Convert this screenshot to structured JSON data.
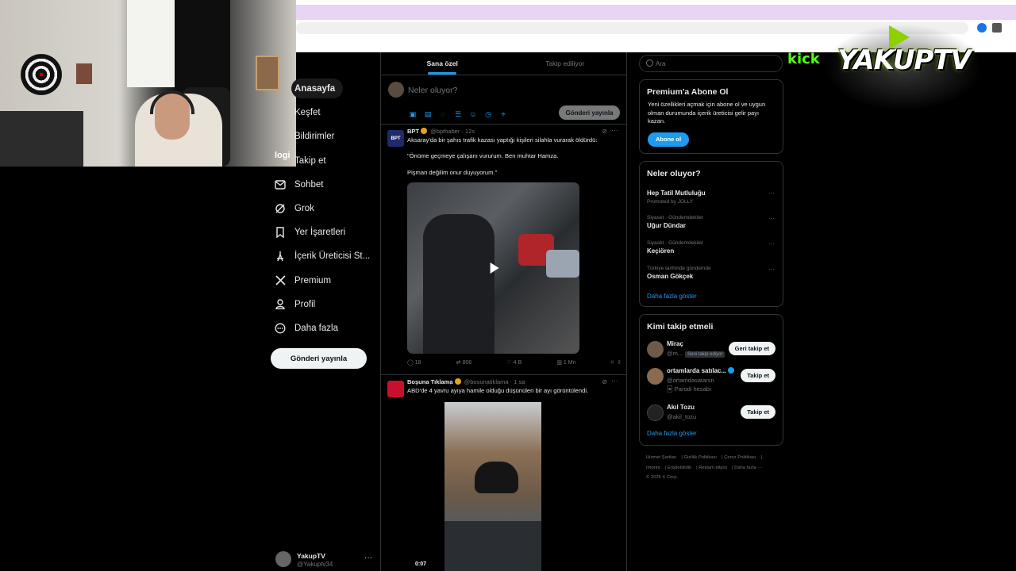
{
  "nav": {
    "items": [
      {
        "label": "Anasayfa",
        "icon": "home-icon"
      },
      {
        "label": "Keşfet",
        "icon": "search-icon"
      },
      {
        "label": "Bildirimler",
        "icon": "bell-icon"
      },
      {
        "label": "Takip et",
        "icon": "follow-icon"
      },
      {
        "label": "Sohbet",
        "icon": "mail-icon"
      },
      {
        "label": "Grok",
        "icon": "grok-icon"
      },
      {
        "label": "Yer İşaretleri",
        "icon": "bookmark-icon"
      },
      {
        "label": "İçerik Üreticisi St...",
        "icon": "creator-studio-icon"
      },
      {
        "label": "Premium",
        "icon": "x-logo-icon"
      },
      {
        "label": "Profil",
        "icon": "profile-icon"
      },
      {
        "label": "Daha fazla",
        "icon": "more-circle-icon"
      }
    ],
    "post_button": "Gönderi yayınla"
  },
  "account": {
    "name": "YakupTV",
    "handle": "@Yakuptv34",
    "more": "···"
  },
  "overlay": {
    "logi": "logi",
    "kick": "kick",
    "yakup": "YAKUPTV"
  },
  "tabs": [
    {
      "label": "Sana özel",
      "active": true
    },
    {
      "label": "Takip ediliyor",
      "active": false
    }
  ],
  "composer": {
    "placeholder": "Neler oluyor?",
    "post_button": "Gönderi yayınla"
  },
  "tweets": [
    {
      "name": "BPT",
      "handle": "@bpthaber · 12s",
      "lines": [
        "Aksaray'da bir şahıs trafik kazası yaptığı kişileri silahla vurarak öldürdü:",
        "\"Önüme geçmeye çalışanı vururum. Ben muhtar Hamza.",
        "Pişman değilim onur duyuyorum.\""
      ],
      "actions": {
        "replies": "18",
        "retweets": "806",
        "likes": "4 B",
        "views": "1 Mn"
      }
    },
    {
      "name": "Boşuna Tıklama",
      "handle": "@bosunatiklama · 1 sa",
      "lines": [
        "ABD'de 4 yavru ayıya hamile olduğu düşünülen bir ayı görüntülendi."
      ],
      "duration": "0:07"
    }
  ],
  "search": {
    "placeholder": "Ara"
  },
  "premium": {
    "title": "Premium'a Abone Ol",
    "desc": "Yeni özellikleri açmak için abone ol ve uygun olman durumunda içerik üreticisi gelir payı kazan.",
    "button": "Abone ol"
  },
  "trends": {
    "title": "Neler oluyor?",
    "items": [
      {
        "category": "",
        "title": "Hep Tatil Mutluluğu",
        "sub": "Promoted by JOLLY"
      },
      {
        "category": "Siyaset · Gündemdekiler",
        "title": "Uğur Dündar",
        "sub": ""
      },
      {
        "category": "Siyaset · Gündemdekiler",
        "title": "Keçiören",
        "sub": ""
      },
      {
        "category": "Türkiye tarihinde gündemde",
        "title": "Osman Gökçek",
        "sub": ""
      }
    ],
    "show_more": "Daha fazla göster"
  },
  "who_to_follow": {
    "title": "Kimi takip etmeli",
    "items": [
      {
        "name": "Miraç",
        "handle": "@m...",
        "tag": "Seni takip ediyor",
        "button": "Geri takip et",
        "parodi": ""
      },
      {
        "name": "ortamlarda satılac...",
        "handle": "@ortamdasatarsn",
        "tag": "",
        "button": "Takip et",
        "parodi": "Parodi hesabı"
      },
      {
        "name": "Akıl Tozu",
        "handle": "@akil_tozu",
        "tag": "",
        "button": "Takip et",
        "parodi": ""
      }
    ],
    "show_more": "Daha fazla göster"
  },
  "footer": [
    "Hizmet Şartları",
    "Gizlilik Politikası",
    "Çerez Politikası",
    "Imprint",
    "Erişilebilirlik",
    "Reklam bilgisi",
    "Daha fazla ···",
    "© 2026 X Corp."
  ],
  "colors": {
    "accent": "#1d9bf0",
    "background": "#000000",
    "border": "#2f3336",
    "muted": "#71767b"
  }
}
